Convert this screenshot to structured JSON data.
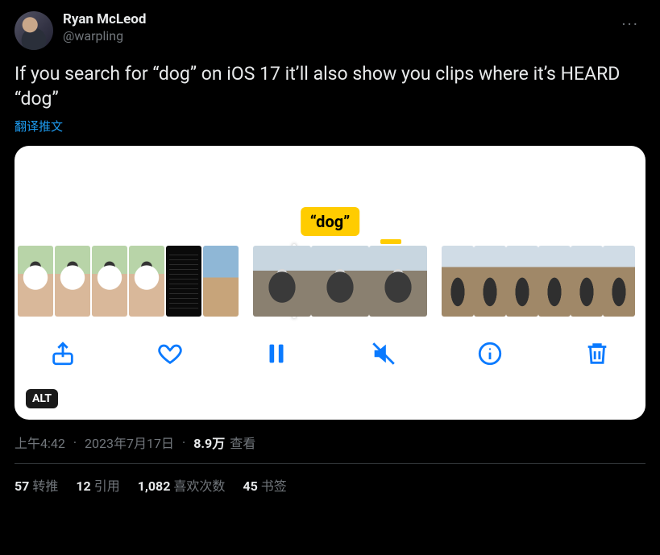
{
  "author": {
    "display_name": "Ryan McLeod",
    "handle": "@warpling"
  },
  "more_label": "···",
  "tweet_text": "If you search for “dog” on iOS 17 it’ll also show you clips where it’s HEARD “dog”",
  "translate_label": "翻译推文",
  "media": {
    "tag_text": "“dog”",
    "alt_badge": "ALT",
    "toolbar": {
      "share": "share",
      "like": "like",
      "pause": "pause",
      "mute": "mute",
      "info": "info",
      "trash": "trash"
    }
  },
  "meta": {
    "time": "上午4:42",
    "date": "2023年7月17日",
    "views_count": "8.9万",
    "views_label": "查看"
  },
  "stats": {
    "retweets_count": "57",
    "retweets_label": "转推",
    "quotes_count": "12",
    "quotes_label": "引用",
    "likes_count": "1,082",
    "likes_label": "喜欢次数",
    "bookmarks_count": "45",
    "bookmarks_label": "书签"
  }
}
